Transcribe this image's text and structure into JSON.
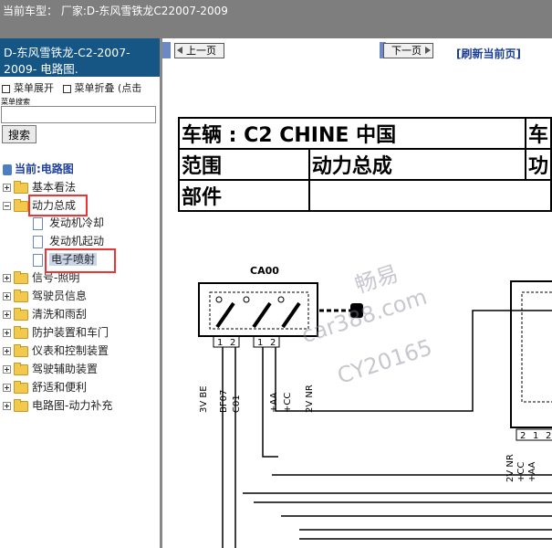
{
  "topbar": {
    "title": "当前车型：  厂家:D-东风雪铁龙C22007-2009"
  },
  "left": {
    "title_line1": "D-东风雪铁龙-C2-2007-",
    "title_line2": "2009- 电路图.",
    "expand_label": "菜单展开",
    "collapse_label": "菜单折叠 (点击",
    "search_label": "菜单搜索",
    "search_value": "",
    "search_button": "搜索",
    "current_label": "当前:电路图",
    "tree": [
      {
        "label": "基本看法",
        "kind": "folder",
        "state": "plus"
      },
      {
        "label": "动力总成",
        "kind": "folder",
        "state": "minus"
      },
      {
        "label": "发动机冷却",
        "kind": "doc"
      },
      {
        "label": "发动机起动",
        "kind": "doc"
      },
      {
        "label": "电子喷射",
        "kind": "doc",
        "selected": true
      },
      {
        "label": "信号-照明",
        "kind": "folder",
        "state": "plus"
      },
      {
        "label": "驾驶员信息",
        "kind": "folder",
        "state": "plus"
      },
      {
        "label": "清洗和雨刮",
        "kind": "folder",
        "state": "plus"
      },
      {
        "label": "防护装置和车门",
        "kind": "folder",
        "state": "plus"
      },
      {
        "label": "仪表和控制装置",
        "kind": "folder",
        "state": "plus"
      },
      {
        "label": "驾驶辅助装置",
        "kind": "folder",
        "state": "plus"
      },
      {
        "label": "舒适和便利",
        "kind": "folder",
        "state": "plus"
      },
      {
        "label": "电路图-动力补充",
        "kind": "folder",
        "state": "plus"
      }
    ]
  },
  "nav": {
    "prev": "上一页",
    "next": "下一页",
    "refresh": "[刷新当前页]"
  },
  "doc_header": {
    "vehicle": "车辆 : C2 CHINE 中国",
    "vehicle_cut": "车",
    "scope": "范围",
    "scope_value": "动力总成",
    "scope_cut": "功",
    "part": "部件"
  },
  "diagram": {
    "connector": "CA00",
    "pin1": "1",
    "pin2": "2",
    "left_pins": [
      "3V BE",
      "BF07",
      "C01"
    ],
    "right_pins": [
      "+AA",
      "+CC",
      "2V NR"
    ],
    "right_box_pins": [
      "2V NR",
      "+CC",
      "+AA"
    ],
    "right_box_nums": [
      "2",
      "1",
      "2"
    ]
  },
  "watermark": {
    "line1": "畅易",
    "line2": "car388.com",
    "line3": "CY20165"
  },
  "colors": {
    "topbar": "#7e7e7e",
    "left_title": "#155685",
    "highlight": "#e33333"
  }
}
